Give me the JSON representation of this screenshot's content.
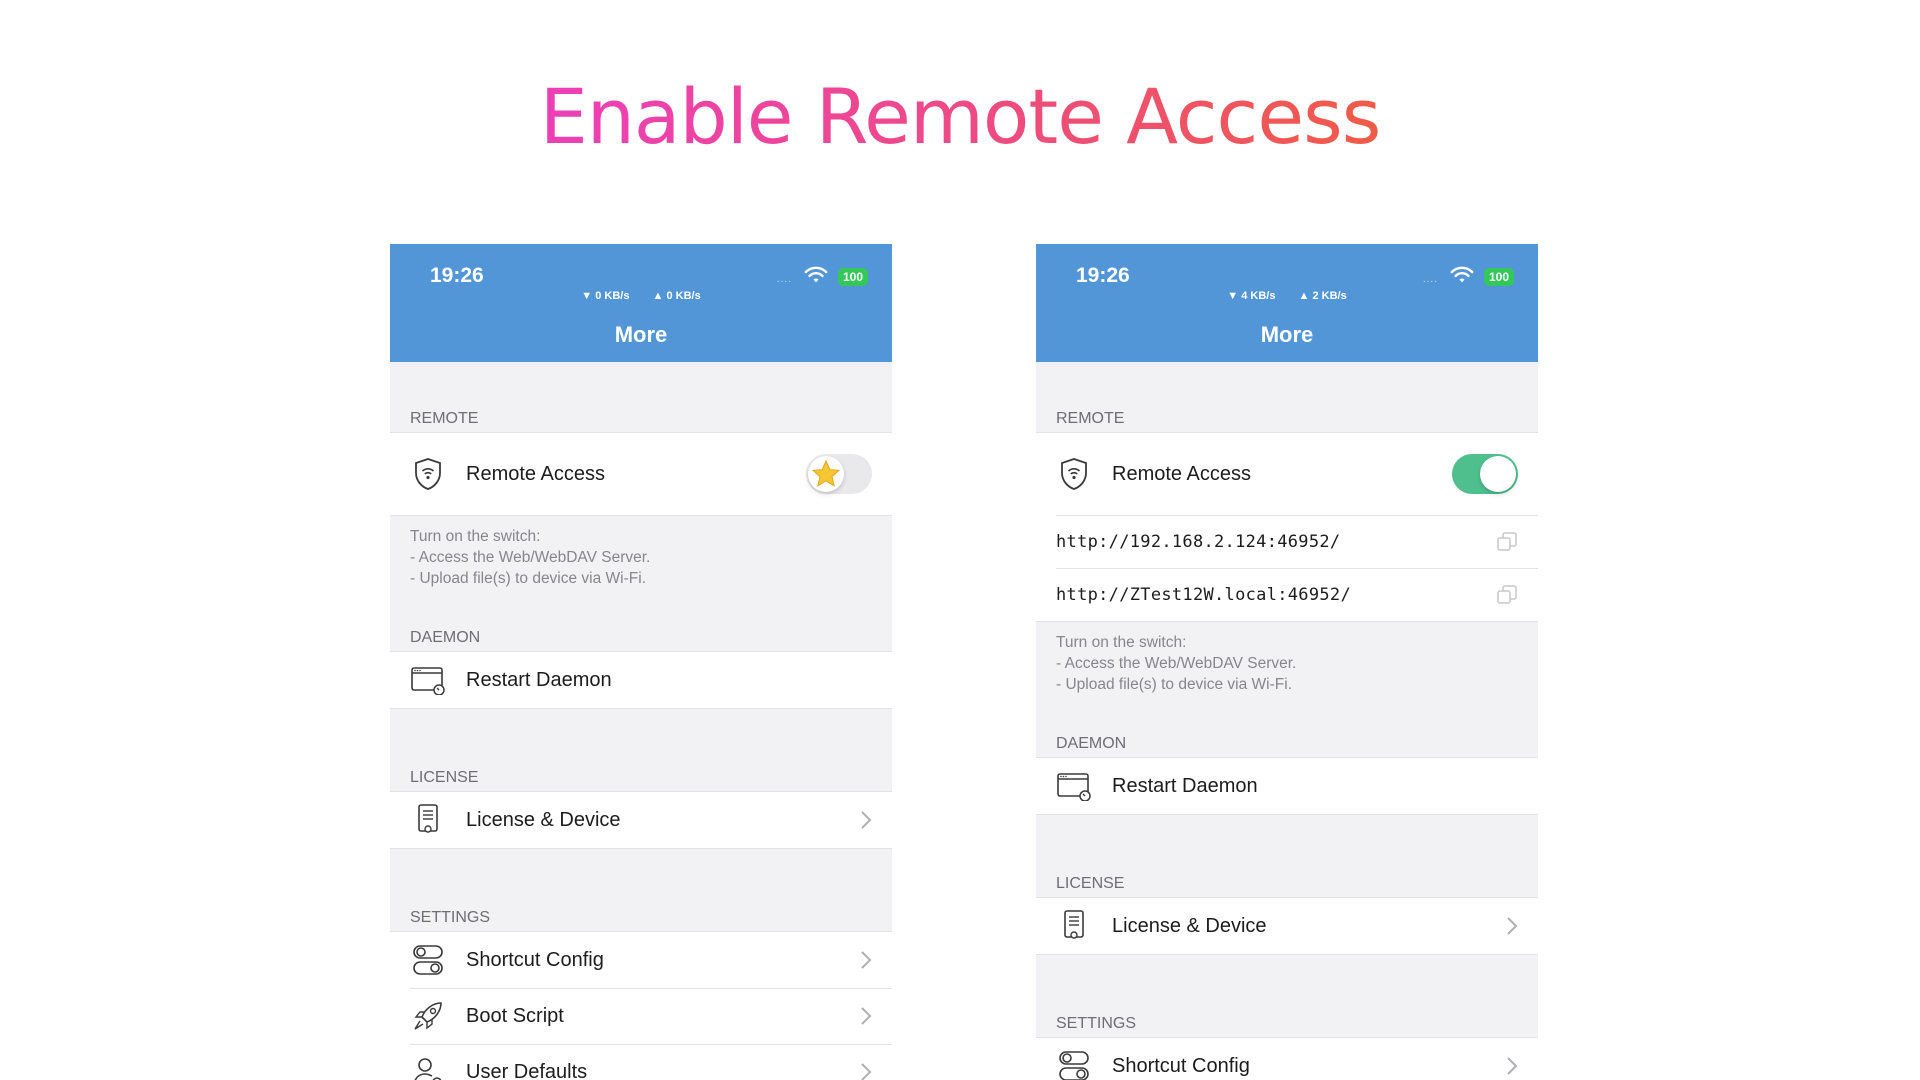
{
  "title": "Enable Remote Access",
  "phones": [
    {
      "status": {
        "time": "19:26",
        "down": "▼ 0 KB/s",
        "up": "▲ 0 KB/s",
        "signal": "....",
        "battery": "100"
      },
      "nav_title": "More",
      "remote": {
        "header": "REMOTE",
        "toggle_label": "Remote Access",
        "toggle_state": "off",
        "note": [
          "Turn on the switch:",
          "- Access the Web/WebDAV Server.",
          "- Upload file(s) to device via Wi-Fi."
        ]
      },
      "daemon": {
        "header": "DAEMON",
        "label": "Restart Daemon"
      },
      "license": {
        "header": "LICENSE",
        "label": "License & Device"
      },
      "settings": {
        "header": "SETTINGS",
        "items": [
          {
            "label": "Shortcut Config",
            "icon": "toggles-icon"
          },
          {
            "label": "Boot Script",
            "icon": "rocket-icon"
          },
          {
            "label": "User Defaults",
            "icon": "user-gear-icon"
          }
        ]
      }
    },
    {
      "status": {
        "time": "19:26",
        "down": "▼ 4 KB/s",
        "up": "▲ 2 KB/s",
        "signal": "....",
        "battery": "100"
      },
      "nav_title": "More",
      "remote": {
        "header": "REMOTE",
        "toggle_label": "Remote Access",
        "toggle_state": "on",
        "urls": [
          "http://192.168.2.124:46952/",
          "http://ZTest12W.local:46952/"
        ],
        "note": [
          "Turn on the switch:",
          "- Access the Web/WebDAV Server.",
          "- Upload file(s) to device via Wi-Fi."
        ]
      },
      "daemon": {
        "header": "DAEMON",
        "label": "Restart Daemon"
      },
      "license": {
        "header": "LICENSE",
        "label": "License & Device"
      },
      "settings": {
        "header": "SETTINGS",
        "items": [
          {
            "label": "Shortcut Config",
            "icon": "toggles-icon"
          }
        ]
      }
    }
  ],
  "colors": {
    "nav": "#5396d8",
    "toggle_on": "#4fbf8e",
    "battery": "#34c759"
  }
}
